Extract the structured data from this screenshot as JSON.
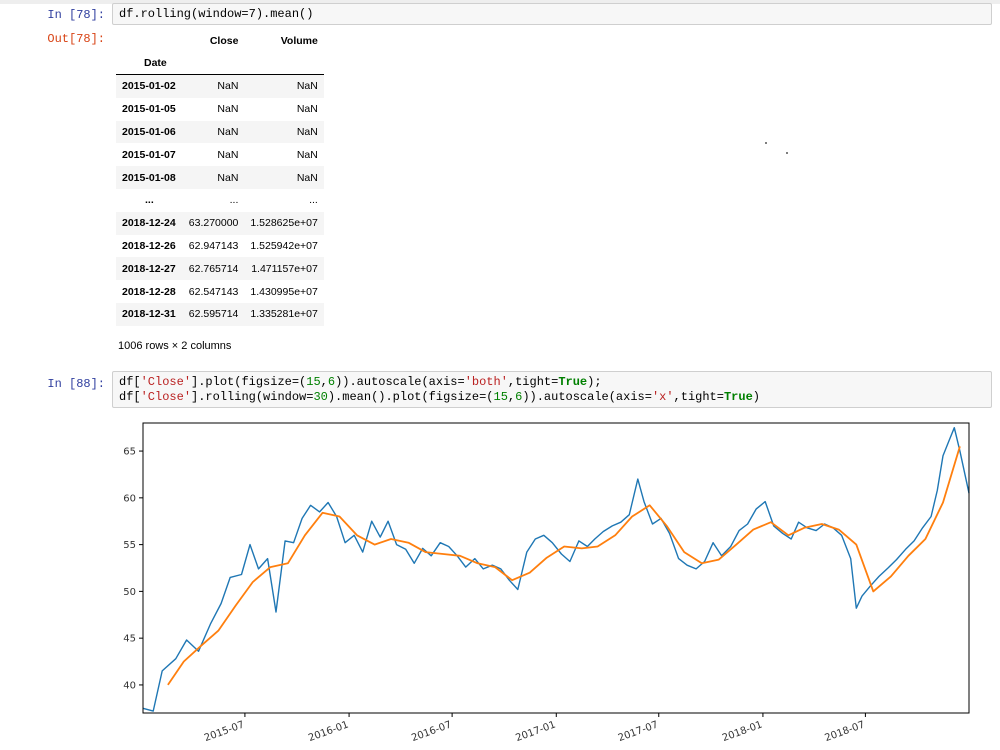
{
  "cells": {
    "cell1": {
      "prompt_in": "In [78]:",
      "prompt_out": "Out[78]:",
      "code": "df.rolling(window=7).mean()"
    },
    "cell2": {
      "prompt_in": "In [88]:",
      "line1": {
        "a": "df[",
        "s1": "'Close'",
        "b": "].plot(figsize=(",
        "n1": "15",
        "c": ",",
        "n2": "6",
        "d": ")).autoscale(axis=",
        "s2": "'both'",
        "e": ",tight=",
        "k": "True",
        "f": ");"
      },
      "line2": {
        "a": "df[",
        "s1": "'Close'",
        "b": "].rolling(window=",
        "n0": "30",
        "b2": ").mean().plot(figsize=(",
        "n1": "15",
        "c": ",",
        "n2": "6",
        "d": ")).autoscale(axis=",
        "s2": "'x'",
        "e": ",tight=",
        "k": "True",
        "f": ")"
      }
    }
  },
  "dataframe": {
    "columns": [
      "Close",
      "Volume"
    ],
    "index_name": "Date",
    "rows": [
      [
        "2015-01-02",
        "NaN",
        "NaN"
      ],
      [
        "2015-01-05",
        "NaN",
        "NaN"
      ],
      [
        "2015-01-06",
        "NaN",
        "NaN"
      ],
      [
        "2015-01-07",
        "NaN",
        "NaN"
      ],
      [
        "2015-01-08",
        "NaN",
        "NaN"
      ],
      [
        "...",
        "...",
        "..."
      ],
      [
        "2018-12-24",
        "63.270000",
        "1.528625e+07"
      ],
      [
        "2018-12-26",
        "62.947143",
        "1.525942e+07"
      ],
      [
        "2018-12-27",
        "62.765714",
        "1.471157e+07"
      ],
      [
        "2018-12-28",
        "62.547143",
        "1.430995e+07"
      ],
      [
        "2018-12-31",
        "62.595714",
        "1.335281e+07"
      ]
    ],
    "shape_text": "1006 rows × 2 columns"
  },
  "chart_data": {
    "type": "line",
    "xlim": [
      "2015-01-02",
      "2018-12-31"
    ],
    "ylim": [
      37,
      68
    ],
    "yticks": [
      40,
      45,
      50,
      55,
      60,
      65
    ],
    "xticks": [
      "2015-07",
      "2016-01",
      "2016-07",
      "2017-01",
      "2017-07",
      "2018-01",
      "2018-07"
    ],
    "colors": {
      "close": "#1f77b4",
      "rolling": "#ff7f0e"
    },
    "series": [
      {
        "key": "close",
        "x": [
          "2015-01-02",
          "2015-01-20",
          "2015-02-05",
          "2015-03-01",
          "2015-03-20",
          "2015-04-10",
          "2015-05-01",
          "2015-05-20",
          "2015-06-05",
          "2015-06-25",
          "2015-07-10",
          "2015-07-25",
          "2015-08-10",
          "2015-08-25",
          "2015-09-10",
          "2015-09-25",
          "2015-10-10",
          "2015-10-25",
          "2015-11-10",
          "2015-11-25",
          "2015-12-10",
          "2015-12-25",
          "2016-01-10",
          "2016-01-25",
          "2016-02-10",
          "2016-02-25",
          "2016-03-10",
          "2016-03-25",
          "2016-04-10",
          "2016-04-25",
          "2016-05-10",
          "2016-05-25",
          "2016-06-10",
          "2016-06-25",
          "2016-07-10",
          "2016-07-25",
          "2016-08-10",
          "2016-08-25",
          "2016-09-10",
          "2016-09-25",
          "2016-10-10",
          "2016-10-25",
          "2016-11-10",
          "2016-11-25",
          "2016-12-10",
          "2016-12-25",
          "2017-01-10",
          "2017-01-25",
          "2017-02-10",
          "2017-02-25",
          "2017-03-10",
          "2017-03-25",
          "2017-04-10",
          "2017-04-25",
          "2017-05-10",
          "2017-05-25",
          "2017-06-05",
          "2017-06-20",
          "2017-07-05",
          "2017-07-20",
          "2017-08-05",
          "2017-08-20",
          "2017-09-05",
          "2017-09-20",
          "2017-10-05",
          "2017-10-20",
          "2017-11-05",
          "2017-11-20",
          "2017-12-05",
          "2017-12-20",
          "2018-01-05",
          "2018-01-20",
          "2018-02-05",
          "2018-02-20",
          "2018-03-05",
          "2018-03-20",
          "2018-04-05",
          "2018-04-20",
          "2018-05-05",
          "2018-05-20",
          "2018-06-05",
          "2018-06-15",
          "2018-06-25",
          "2018-07-10",
          "2018-07-25",
          "2018-08-10",
          "2018-08-25",
          "2018-09-10",
          "2018-09-25",
          "2018-10-10",
          "2018-10-25",
          "2018-11-05",
          "2018-11-15",
          "2018-11-25",
          "2018-12-05",
          "2018-12-15",
          "2018-12-31"
        ],
        "y": [
          37.5,
          37.2,
          41.5,
          42.8,
          44.8,
          43.6,
          46.5,
          48.7,
          51.5,
          51.8,
          55.0,
          52.4,
          53.5,
          47.8,
          55.4,
          55.2,
          57.8,
          59.2,
          58.5,
          59.5,
          58.0,
          55.2,
          56.0,
          54.2,
          57.5,
          55.8,
          57.5,
          55.0,
          54.5,
          53.0,
          54.6,
          53.8,
          55.2,
          54.8,
          53.8,
          52.6,
          53.5,
          52.4,
          52.8,
          52.4,
          51.2,
          50.2,
          54.2,
          55.6,
          56.0,
          55.2,
          54.0,
          53.2,
          55.4,
          54.8,
          55.6,
          56.4,
          57.0,
          57.4,
          58.2,
          62.0,
          59.6,
          57.2,
          57.8,
          56.2,
          53.5,
          52.8,
          52.4,
          53.2,
          55.2,
          53.8,
          54.8,
          56.5,
          57.2,
          58.8,
          59.6,
          57.0,
          56.2,
          55.6,
          57.4,
          56.8,
          56.5,
          57.2,
          56.8,
          56.0,
          53.5,
          48.2,
          49.5,
          50.6,
          51.6,
          52.5,
          53.4,
          54.5,
          55.4,
          56.8,
          58.0,
          60.8,
          64.5,
          66.0,
          67.5,
          65.0,
          60.5
        ]
      },
      {
        "key": "rolling",
        "x": [
          "2015-02-15",
          "2015-03-15",
          "2015-04-15",
          "2015-05-15",
          "2015-06-15",
          "2015-07-15",
          "2015-08-15",
          "2015-09-15",
          "2015-10-15",
          "2015-11-15",
          "2015-12-15",
          "2016-01-15",
          "2016-02-15",
          "2016-03-15",
          "2016-04-15",
          "2016-05-15",
          "2016-06-15",
          "2016-07-15",
          "2016-08-15",
          "2016-09-15",
          "2016-10-15",
          "2016-11-15",
          "2016-12-15",
          "2017-01-15",
          "2017-02-15",
          "2017-03-15",
          "2017-04-15",
          "2017-05-15",
          "2017-06-15",
          "2017-07-15",
          "2017-08-15",
          "2017-09-15",
          "2017-10-15",
          "2017-11-15",
          "2017-12-15",
          "2018-01-15",
          "2018-02-15",
          "2018-03-15",
          "2018-04-15",
          "2018-05-15",
          "2018-06-15",
          "2018-07-15",
          "2018-08-15",
          "2018-09-15",
          "2018-10-15",
          "2018-11-15",
          "2018-12-15"
        ],
        "y": [
          40.0,
          42.5,
          44.2,
          45.8,
          48.5,
          51.0,
          52.6,
          53.0,
          56.0,
          58.4,
          58.0,
          56.0,
          55.0,
          55.6,
          55.2,
          54.2,
          54.0,
          53.8,
          53.0,
          52.6,
          51.2,
          52.0,
          53.6,
          54.8,
          54.6,
          54.8,
          56.0,
          58.0,
          59.2,
          57.0,
          54.2,
          53.0,
          53.4,
          55.0,
          56.6,
          57.4,
          56.0,
          56.8,
          57.2,
          56.6,
          55.0,
          50.0,
          51.6,
          53.8,
          55.6,
          59.5,
          65.5
        ]
      }
    ]
  }
}
